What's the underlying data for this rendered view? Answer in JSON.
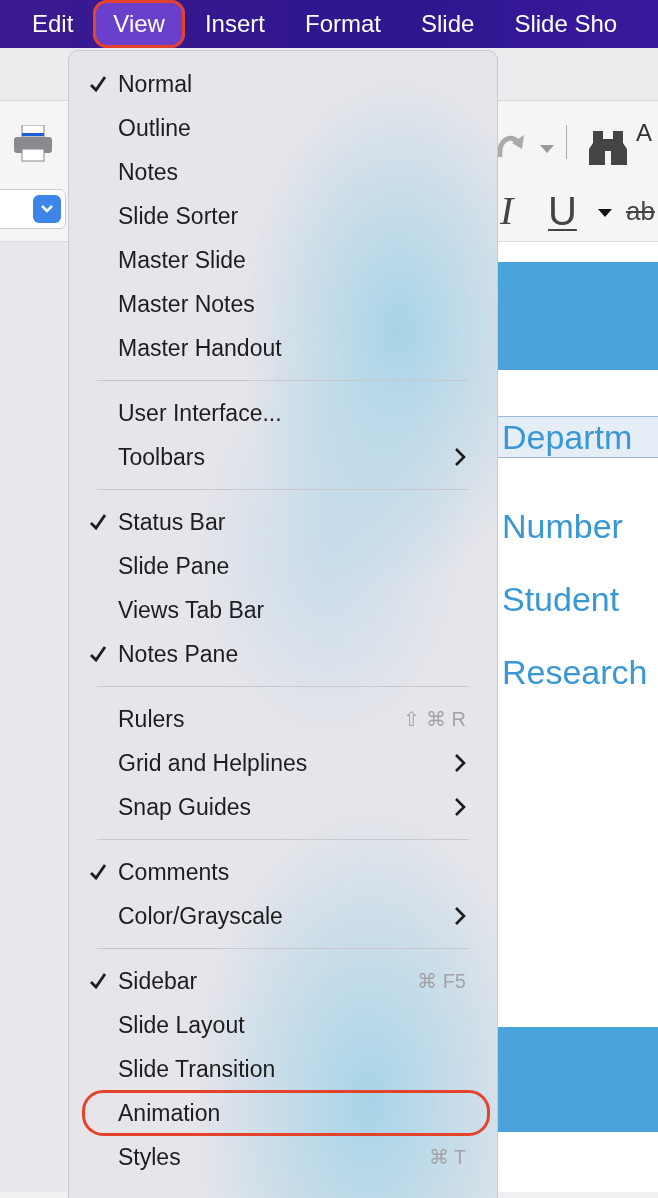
{
  "menubar": {
    "items": [
      {
        "label": "Edit",
        "selected": false,
        "circled": false
      },
      {
        "label": "View",
        "selected": true,
        "circled": true
      },
      {
        "label": "Insert",
        "selected": false,
        "circled": false
      },
      {
        "label": "Format",
        "selected": false,
        "circled": false
      },
      {
        "label": "Slide",
        "selected": false,
        "circled": false
      },
      {
        "label": "Slide Sho",
        "selected": false,
        "circled": false
      }
    ]
  },
  "toolbar": {
    "font_letter": "A",
    "format_buttons": [
      "I",
      "U",
      "ab"
    ]
  },
  "slide": {
    "lines": [
      {
        "text": "Departm",
        "selected": true
      },
      {
        "text": "Number",
        "selected": false
      },
      {
        "text": "Student",
        "selected": false
      },
      {
        "text": "Research",
        "selected": false
      }
    ]
  },
  "menu": {
    "sections": [
      {
        "items": [
          {
            "label": "Normal",
            "checked": true,
            "circled": false
          },
          {
            "label": "Outline",
            "checked": false,
            "circled": false
          },
          {
            "label": "Notes",
            "checked": false,
            "circled": false
          },
          {
            "label": "Slide Sorter",
            "checked": false,
            "circled": false
          },
          {
            "label": "Master Slide",
            "checked": false,
            "circled": false
          },
          {
            "label": "Master Notes",
            "checked": false,
            "circled": false
          },
          {
            "label": "Master Handout",
            "checked": false,
            "circled": false
          }
        ]
      },
      {
        "items": [
          {
            "label": "User Interface...",
            "checked": false,
            "circled": false
          },
          {
            "label": "Toolbars",
            "checked": false,
            "circled": false,
            "submenu": true
          }
        ]
      },
      {
        "items": [
          {
            "label": "Status Bar",
            "checked": true,
            "circled": false
          },
          {
            "label": "Slide Pane",
            "checked": false,
            "circled": false
          },
          {
            "label": "Views Tab Bar",
            "checked": false,
            "circled": false
          },
          {
            "label": "Notes Pane",
            "checked": true,
            "circled": false
          }
        ]
      },
      {
        "items": [
          {
            "label": "Rulers",
            "checked": false,
            "circled": false,
            "shortcut": "⇧ ⌘ R"
          },
          {
            "label": "Grid and Helplines",
            "checked": false,
            "circled": false,
            "submenu": true
          },
          {
            "label": "Snap Guides",
            "checked": false,
            "circled": false,
            "submenu": true
          }
        ]
      },
      {
        "items": [
          {
            "label": "Comments",
            "checked": true,
            "circled": false
          },
          {
            "label": "Color/Grayscale",
            "checked": false,
            "circled": false,
            "submenu": true
          }
        ]
      },
      {
        "items": [
          {
            "label": "Sidebar",
            "checked": true,
            "circled": false,
            "shortcut": "⌘ F5"
          },
          {
            "label": "Slide Layout",
            "checked": false,
            "circled": false
          },
          {
            "label": "Slide Transition",
            "checked": false,
            "circled": false
          },
          {
            "label": "Animation",
            "checked": false,
            "circled": true
          },
          {
            "label": "Styles",
            "checked": false,
            "circled": false,
            "shortcut": "⌘ T"
          }
        ]
      }
    ]
  }
}
